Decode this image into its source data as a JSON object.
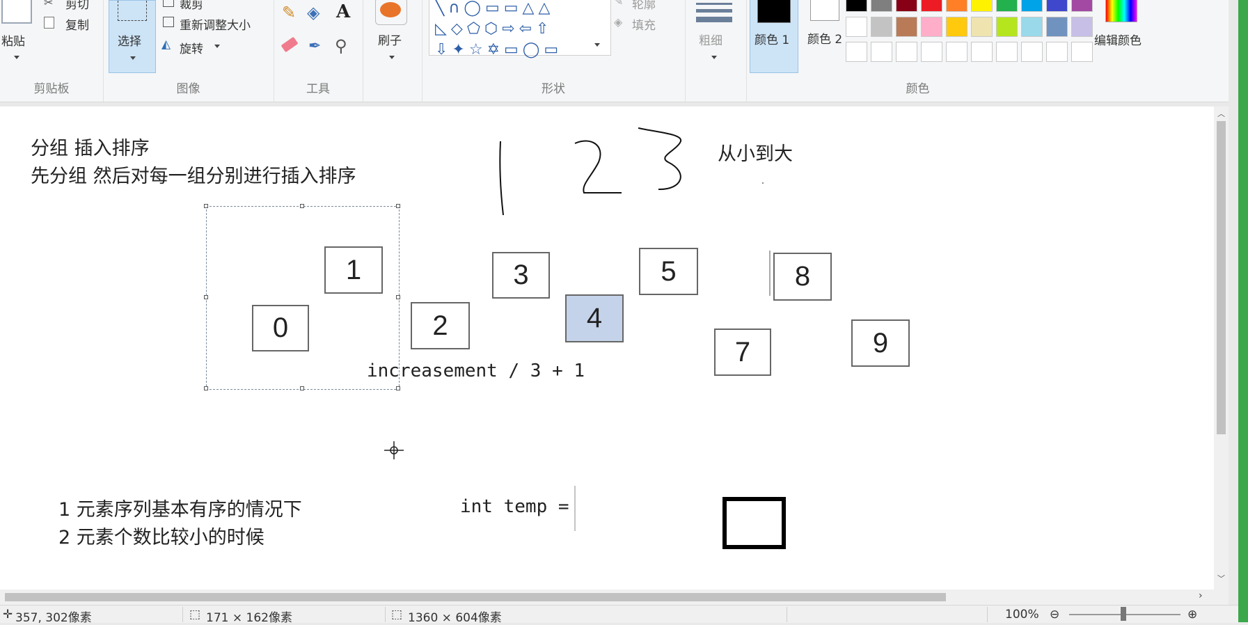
{
  "ribbon": {
    "clipboard": {
      "paste": "粘贴",
      "cut": "剪切",
      "copy": "复制",
      "label": "剪贴板"
    },
    "image": {
      "select": "选择",
      "crop": "裁剪",
      "resize": "重新调整大小",
      "rotate": "旋转",
      "label": "图像"
    },
    "tools": {
      "label": "工具"
    },
    "brushes": {
      "label": "刷子"
    },
    "shapes": {
      "outline": "轮廓",
      "fill": "填充",
      "label": "形状"
    },
    "size": {
      "label": "粗细"
    },
    "colors": {
      "color1": "颜色 1",
      "color2": "颜色 2",
      "edit": "编辑颜色",
      "label": "颜色",
      "color1_value": "#000000",
      "color2_value": "#ffffff",
      "palette_row1": [
        "#000000",
        "#7f7f7f",
        "#880015",
        "#ed1c24",
        "#ff7f27",
        "#fff200",
        "#22b14c",
        "#00a2e8",
        "#3f48cc",
        "#a349a4"
      ],
      "palette_row2": [
        "#ffffff",
        "#c3c3c3",
        "#b97a57",
        "#ffaec9",
        "#ffc90e",
        "#efe4b0",
        "#b5e61d",
        "#99d9ea",
        "#7092be",
        "#c8bfe7"
      ],
      "palette_row3": [
        "#ffffff",
        "#ffffff",
        "#ffffff",
        "#ffffff",
        "#ffffff",
        "#ffffff",
        "#ffffff",
        "#ffffff",
        "#ffffff",
        "#ffffff"
      ]
    }
  },
  "canvas": {
    "title1": "分组  插入排序",
    "title2": "先分组  然后对每一组分别进行插入排序",
    "order_note": "从小到大",
    "formula": "increasement / 3 + 1",
    "temp_code": "int temp =",
    "cond1": "1  元素序列基本有序的情况下",
    "cond2": "2  元素个数比较小的时候",
    "numbers": [
      "0",
      "1",
      "2",
      "3",
      "4",
      "5",
      "7",
      "8",
      "9"
    ],
    "highlighted_number": "4"
  },
  "status": {
    "cursor_pos": "357, 302像素",
    "selection_size": "171 × 162像素",
    "image_size": "1360 × 604像素",
    "zoom": "100%"
  }
}
